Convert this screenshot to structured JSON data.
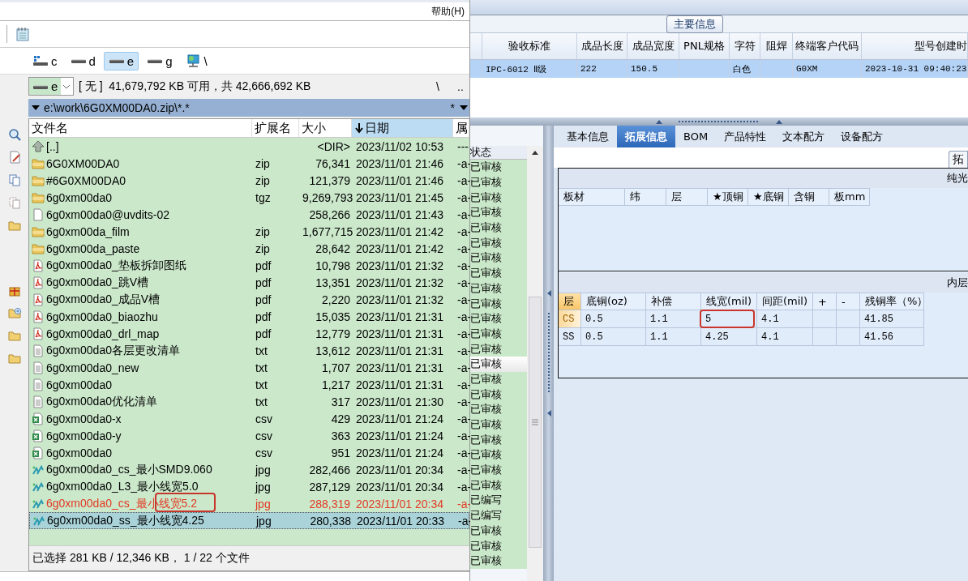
{
  "file_manager": {
    "menu": [
      "帮助(H)"
    ],
    "drives": [
      {
        "kind": "system",
        "label": "c",
        "selected": false
      },
      {
        "kind": "drive",
        "label": "d",
        "selected": false
      },
      {
        "kind": "drive",
        "label": "e",
        "selected": true
      },
      {
        "kind": "drive",
        "label": "g",
        "selected": false
      },
      {
        "kind": "network",
        "label": "\\",
        "selected": false
      }
    ],
    "drive_combo": {
      "value": "e"
    },
    "disk_info": "[ 无 ]  41,679,792 KB 可用，共 42,666,692 KB",
    "root_button": "\\",
    "up_button": "..",
    "path": "e:\\work\\6G0XM00DA0.zip\\*.*",
    "filter": "*",
    "columns": [
      {
        "label": "文件名",
        "sorted": false
      },
      {
        "label": "扩展名",
        "sorted": false
      },
      {
        "label": "大小",
        "sorted": false
      },
      {
        "label": "日期",
        "sorted": true
      },
      {
        "label": "属",
        "sorted": false
      }
    ],
    "files": [
      {
        "kind": "parent",
        "name": "[..]",
        "size": "<DIR>",
        "date": "2023/11/02 10:53",
        "attr": "---",
        "marked": false,
        "cursor": false,
        "annotated": false
      },
      {
        "kind": "archive",
        "name": "6G0XM00DA0",
        "ext": "zip",
        "size": "76,341",
        "date": "2023/11/01 21:46",
        "attr": "-a-",
        "marked": false,
        "cursor": false,
        "annotated": false
      },
      {
        "kind": "archive",
        "name": "#6G0XM00DA0",
        "ext": "zip",
        "size": "121,379",
        "date": "2023/11/01 21:46",
        "attr": "-a-",
        "marked": false,
        "cursor": false,
        "annotated": false
      },
      {
        "kind": "archive",
        "name": "6g0xm00da0",
        "ext": "tgz",
        "size": "9,269,793",
        "date": "2023/11/01 21:45",
        "attr": "-a-",
        "marked": false,
        "cursor": false,
        "annotated": false
      },
      {
        "kind": "file",
        "name": "6g0xm00da0@uvdits-02",
        "size": "258,266",
        "date": "2023/11/01 21:43",
        "attr": "-a-",
        "marked": false,
        "cursor": false,
        "annotated": false
      },
      {
        "kind": "archive",
        "name": "6g0xm00da_film",
        "ext": "zip",
        "size": "1,677,715",
        "date": "2023/11/01 21:42",
        "attr": "-a-",
        "marked": false,
        "cursor": false,
        "annotated": false
      },
      {
        "kind": "archive",
        "name": "6g0xm00da_paste",
        "ext": "zip",
        "size": "28,642",
        "date": "2023/11/01 21:42",
        "attr": "-a-",
        "marked": false,
        "cursor": false,
        "annotated": false
      },
      {
        "kind": "pdf",
        "name": "6g0xm00da0_垫板拆卸图纸",
        "ext": "pdf",
        "size": "10,798",
        "date": "2023/11/01 21:32",
        "attr": "-a-",
        "marked": false,
        "cursor": false,
        "annotated": false
      },
      {
        "kind": "pdf",
        "name": "6g0xm00da0_跳V槽",
        "ext": "pdf",
        "size": "13,351",
        "date": "2023/11/01 21:32",
        "attr": "-a-",
        "marked": false,
        "cursor": false,
        "annotated": false
      },
      {
        "kind": "pdf",
        "name": "6g0xm00da0_成品V槽",
        "ext": "pdf",
        "size": "2,220",
        "date": "2023/11/01 21:32",
        "attr": "-a-",
        "marked": false,
        "cursor": false,
        "annotated": false
      },
      {
        "kind": "pdf",
        "name": "6g0xm00da0_biaozhu",
        "ext": "pdf",
        "size": "15,035",
        "date": "2023/11/01 21:31",
        "attr": "-a-",
        "marked": false,
        "cursor": false,
        "annotated": false
      },
      {
        "kind": "pdf",
        "name": "6g0xm00da0_drl_map",
        "ext": "pdf",
        "size": "12,779",
        "date": "2023/11/01 21:31",
        "attr": "-a-",
        "marked": false,
        "cursor": false,
        "annotated": false
      },
      {
        "kind": "text",
        "name": "6g0xm00da0各层更改清单",
        "ext": "txt",
        "size": "13,612",
        "date": "2023/11/01 21:31",
        "attr": "-a-",
        "marked": false,
        "cursor": false,
        "annotated": false
      },
      {
        "kind": "text",
        "name": "6g0xm00da0_new",
        "ext": "txt",
        "size": "1,707",
        "date": "2023/11/01 21:31",
        "attr": "-a-",
        "marked": false,
        "cursor": false,
        "annotated": false
      },
      {
        "kind": "text",
        "name": "6g0xm00da0",
        "ext": "txt",
        "size": "1,217",
        "date": "2023/11/01 21:31",
        "attr": "-a-",
        "marked": false,
        "cursor": false,
        "annotated": false
      },
      {
        "kind": "text",
        "name": "6g0xm00da0优化清单",
        "ext": "txt",
        "size": "317",
        "date": "2023/11/01 21:30",
        "attr": "-a-",
        "marked": false,
        "cursor": false,
        "annotated": false
      },
      {
        "kind": "sheet",
        "name": "6g0xm00da0-x",
        "ext": "csv",
        "size": "429",
        "date": "2023/11/01 21:24",
        "attr": "-a-",
        "marked": false,
        "cursor": false,
        "annotated": false
      },
      {
        "kind": "sheet",
        "name": "6g0xm00da0-y",
        "ext": "csv",
        "size": "363",
        "date": "2023/11/01 21:24",
        "attr": "-a-",
        "marked": false,
        "cursor": false,
        "annotated": false
      },
      {
        "kind": "sheet",
        "name": "6g0xm00da0",
        "ext": "csv",
        "size": "951",
        "date": "2023/11/01 21:24",
        "attr": "-a-",
        "marked": false,
        "cursor": false,
        "annotated": false
      },
      {
        "kind": "image",
        "name": "6g0xm00da0_cs_最小SMD9.060",
        "ext": "jpg",
        "size": "282,466",
        "date": "2023/11/01 20:34",
        "attr": "-a-",
        "marked": false,
        "cursor": false,
        "annotated": false
      },
      {
        "kind": "image",
        "name": "6g0xm00da0_L3_最小线宽5.0",
        "ext": "jpg",
        "size": "287,129",
        "date": "2023/11/01 20:34",
        "attr": "-a-",
        "marked": false,
        "cursor": false,
        "annotated": false
      },
      {
        "kind": "image",
        "name": "6g0xm00da0_cs_最小线宽5.2",
        "ext": "jpg",
        "size": "288,319",
        "date": "2023/11/01 20:34",
        "attr": "-a-",
        "marked": true,
        "cursor": false,
        "annotated": true
      },
      {
        "kind": "image",
        "name": "6g0xm00da0_ss_最小线宽4.25",
        "ext": "jpg",
        "size": "280,338",
        "date": "2023/11/01 20:33",
        "attr": "-a-",
        "marked": false,
        "cursor": true,
        "annotated": false
      }
    ],
    "status": "已选择 281 KB / 12,346 KB， 1 / 22 个文件"
  },
  "erp": {
    "group_title": "主要信息",
    "columns": [
      "验收标准",
      "成品长度",
      "成品宽度",
      "PNL规格",
      "字符",
      "阻焊",
      "终端客户代码",
      "型号创建时"
    ],
    "rows": [
      {
        "selected": true,
        "cells": [
          "IPC-6012 Ⅱ级",
          "222",
          "150.5",
          null,
          "白色",
          null,
          "G0XM",
          "2023-10-31 09:40:23"
        ]
      }
    ],
    "status_header": "状态",
    "status_rows": [
      {
        "label": "已审核",
        "highlighted": false
      },
      {
        "label": "已审核",
        "highlighted": false
      },
      {
        "label": "已审核",
        "highlighted": false
      },
      {
        "label": "已审核",
        "highlighted": false
      },
      {
        "label": "已审核",
        "highlighted": false
      },
      {
        "label": "已审核",
        "highlighted": false
      },
      {
        "label": "已审核",
        "highlighted": false
      },
      {
        "label": "已审核",
        "highlighted": false
      },
      {
        "label": "已审核",
        "highlighted": false
      },
      {
        "label": "已审核",
        "highlighted": false
      },
      {
        "label": "已审核",
        "highlighted": false
      },
      {
        "label": "已审核",
        "highlighted": false
      },
      {
        "label": "已审核",
        "highlighted": false
      },
      {
        "label": "已审核",
        "highlighted": true
      },
      {
        "label": "已审核",
        "highlighted": false
      },
      {
        "label": "已审核",
        "highlighted": false
      },
      {
        "label": "已审核",
        "highlighted": false
      },
      {
        "label": "已审核",
        "highlighted": false
      },
      {
        "label": "已审核",
        "highlighted": false
      },
      {
        "label": "已审核",
        "highlighted": false
      },
      {
        "label": "已审核",
        "highlighted": false
      },
      {
        "label": "已审核",
        "highlighted": false
      },
      {
        "label": "已编写",
        "highlighted": false
      },
      {
        "label": "已编写",
        "highlighted": false
      },
      {
        "label": "已审核",
        "highlighted": false
      },
      {
        "label": "已审核",
        "highlighted": false
      },
      {
        "label": "已审核",
        "highlighted": false
      }
    ],
    "tabs": [
      {
        "label": "基本信息",
        "selected": false
      },
      {
        "label": "拓展信息",
        "selected": true
      },
      {
        "label": "BOM",
        "selected": false
      },
      {
        "label": "产品特性",
        "selected": false
      },
      {
        "label": "文本配方",
        "selected": false
      },
      {
        "label": "设备配方",
        "selected": false
      }
    ],
    "panel_title": "拓",
    "board_section": {
      "title": "纯光",
      "columns": [
        "板材",
        "纬",
        "层",
        "★顶铜",
        "★底铜",
        "含铜",
        "板mm"
      ]
    },
    "layer_section": {
      "title": "内层",
      "layer_header": "层",
      "columns": [
        "底铜(oz)",
        "补偿",
        "线宽(mil)",
        "间距(mil)",
        "+",
        "-",
        "残铜率（%）"
      ],
      "rows": [
        {
          "layer": "CS",
          "current": true,
          "cells": [
            {
              "text": "0.5",
              "annotated": false
            },
            {
              "text": "1.1",
              "annotated": false
            },
            {
              "text": "5",
              "annotated": true
            },
            {
              "text": "4.1",
              "annotated": false
            },
            {
              "annotated": false
            },
            {
              "annotated": false
            },
            {
              "text": "41.85",
              "annotated": false
            }
          ]
        },
        {
          "layer": "SS",
          "current": false,
          "cells": [
            {
              "text": "0.5",
              "annotated": false
            },
            {
              "text": "1.1",
              "annotated": false
            },
            {
              "text": "4.25",
              "annotated": false
            },
            {
              "text": "4.1",
              "annotated": false
            },
            {
              "annotated": false
            },
            {
              "annotated": false
            },
            {
              "text": "41.56",
              "annotated": false
            }
          ]
        }
      ]
    }
  }
}
